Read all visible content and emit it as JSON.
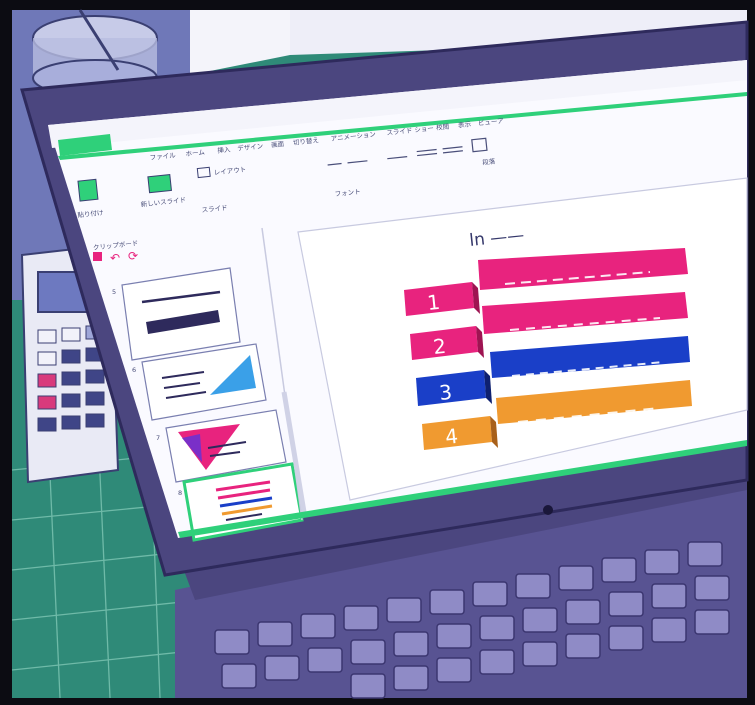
{
  "ribbon": {
    "tabs": [
      "ファイル",
      "ホーム",
      "挿入",
      "デザイン",
      "画面",
      "切り替え",
      "アニメーション",
      "スライド ショー",
      "校閲",
      "表示",
      "ビューア"
    ],
    "groups": {
      "clipboard": "クリップボード",
      "slides": "スライド",
      "font": "フォント",
      "paragraph": "段落"
    },
    "buttons": {
      "paste": "貼り付け",
      "new_slide": "新しいスライド",
      "layout": "レイアウト"
    }
  },
  "thumbnails": [
    {
      "number": "5"
    },
    {
      "number": "6"
    },
    {
      "number": "7"
    },
    {
      "number": "8",
      "selected": true
    }
  ],
  "slide": {
    "handwritten_title": "ln ——",
    "items": [
      {
        "number": "1",
        "color": "#e8237e"
      },
      {
        "number": "2",
        "color": "#e8237e"
      },
      {
        "number": "3",
        "color": "#1a3fc8"
      },
      {
        "number": "4",
        "color": "#f09a30"
      }
    ]
  },
  "colors": {
    "laptop": "#4b467f",
    "screen": "#fafaff",
    "accent_green": "#2fd07a",
    "desk_green": "#2f8a78"
  },
  "icons": [
    "undo-icon",
    "redo-icon",
    "save-icon",
    "camera-icon"
  ]
}
